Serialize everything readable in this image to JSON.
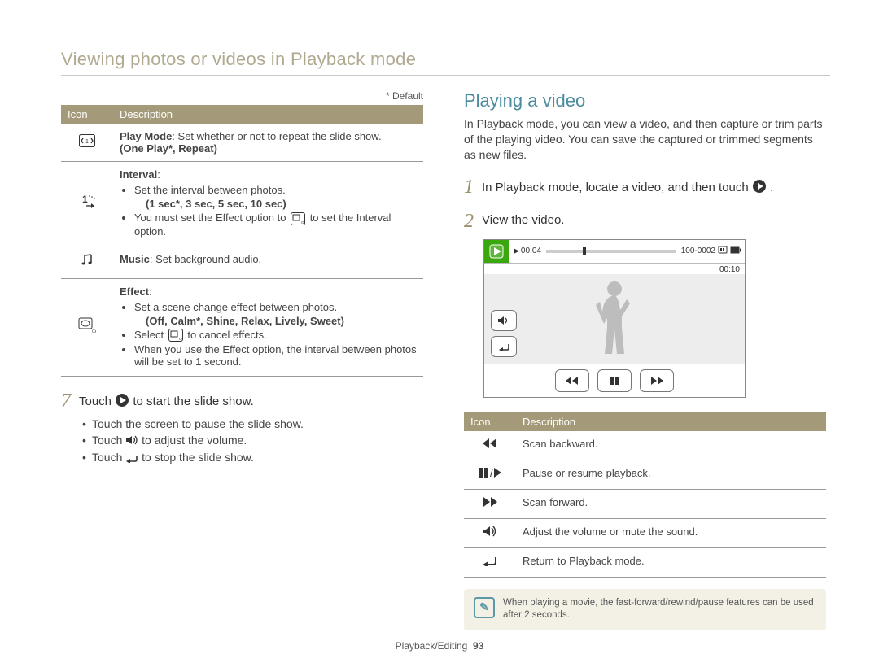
{
  "header": {
    "section_title": "Viewing photos or videos in Playback mode"
  },
  "left": {
    "default_label": "* Default",
    "table": {
      "headers": {
        "icon": "Icon",
        "desc": "Description"
      },
      "rows": [
        {
          "icon_name": "play-mode-icon",
          "desc_lead": "Play Mode",
          "desc_tail": ": Set whether or not to repeat the slide show.",
          "options": "(One Play*, Repeat)"
        },
        {
          "icon_name": "interval-icon",
          "desc_lead": "Interval",
          "desc_tail": ":",
          "bullets": [
            "Set the interval between photos.",
            {
              "options": "(1 sec*, 3 sec, 5 sec, 10 sec)"
            },
            "You must set the Effect option to ▢OFF to set the Interval option."
          ]
        },
        {
          "icon_name": "music-icon",
          "desc_lead": "Music",
          "desc_tail": ": Set background audio."
        },
        {
          "icon_name": "effect-icon",
          "desc_lead": "Effect",
          "desc_tail": ":",
          "bullets": [
            "Set a scene change effect between photos.",
            {
              "options": "(Off, Calm*, Shine, Relax, Lively, Sweet)"
            },
            "Select ▢OFF to cancel effects.",
            "When you use the Effect option, the interval between photos will be set to 1 second."
          ]
        }
      ]
    },
    "step7": {
      "num": "7",
      "text_pre": "Touch ",
      "text_post": " to start the slide show.",
      "bullets": [
        "Touch the screen to pause the slide show.",
        "Touch 🔊 to adjust the volume.",
        "Touch ↩ to stop the slide show."
      ]
    }
  },
  "right": {
    "title": "Playing a video",
    "intro": "In Playback mode, you can view a video, and then capture or trim parts of the playing video. You can save the captured or trimmed segments as new files.",
    "step1": {
      "num": "1",
      "text_pre": "In Playback mode, locate a video, and then touch ",
      "text_post": "."
    },
    "step2": {
      "num": "2",
      "text": "View the video."
    },
    "video": {
      "elapsed": "00:04",
      "file_id": "100-0002",
      "total": "00:10"
    },
    "table": {
      "headers": {
        "icon": "Icon",
        "desc": "Description"
      },
      "rows": [
        {
          "icon_name": "scan-backward-icon",
          "desc": "Scan backward."
        },
        {
          "icon_name": "pause-play-icon",
          "desc": "Pause or resume playback."
        },
        {
          "icon_name": "scan-forward-icon",
          "desc": "Scan forward."
        },
        {
          "icon_name": "volume-icon",
          "desc": "Adjust the volume or mute the sound."
        },
        {
          "icon_name": "return-icon",
          "desc": "Return to Playback mode."
        }
      ]
    },
    "note": "When playing a movie, the fast-forward/rewind/pause features can be used after 2 seconds."
  },
  "footer": {
    "section": "Playback/Editing",
    "page": "93"
  }
}
